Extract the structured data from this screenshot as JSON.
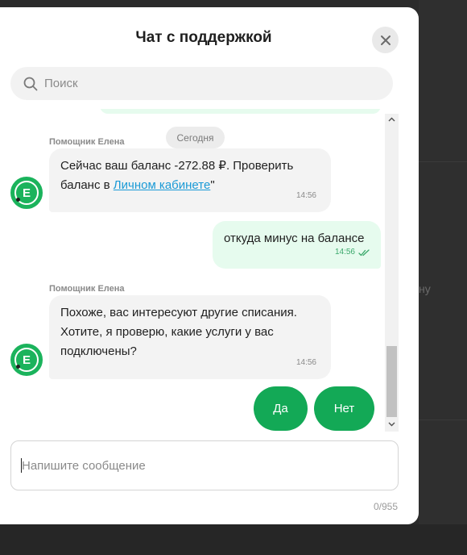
{
  "chat": {
    "title": "Чат с поддержкой",
    "search_placeholder": "Поиск",
    "date_label": "Сегодня",
    "messages": [
      {
        "sender": "Помощник Елена",
        "text_before": "Сейчас ваш баланс -272.88 ₽. Проверить баланс в ",
        "link_text": "Личном кабинете",
        "text_after": "\"",
        "time": "14:56"
      },
      {
        "text": "откуда минус на балансе",
        "time": "14:56"
      },
      {
        "sender": "Помощник Елена",
        "text": "Похоже, вас интересуют другие списания. Хотите, я проверю, какие услуги у вас подключены?",
        "time": "14:56"
      }
    ],
    "avatar_letter": "E",
    "quick_replies": [
      "Да",
      "Нет"
    ],
    "composer_placeholder": "Напишите сообщение",
    "char_counter": "0/955"
  },
  "background": {
    "partial_text": "ну"
  },
  "colors": {
    "accent_green": "#13a956",
    "outgoing_bubble": "#e6fbee",
    "incoming_bubble": "#f3f3f3",
    "link": "#1a9ad6"
  },
  "icons": {
    "close": "close-icon",
    "search": "search-icon",
    "read_receipt": "double-check-icon",
    "scroll_up": "chevron-up-icon",
    "scroll_down": "chevron-down-icon"
  }
}
